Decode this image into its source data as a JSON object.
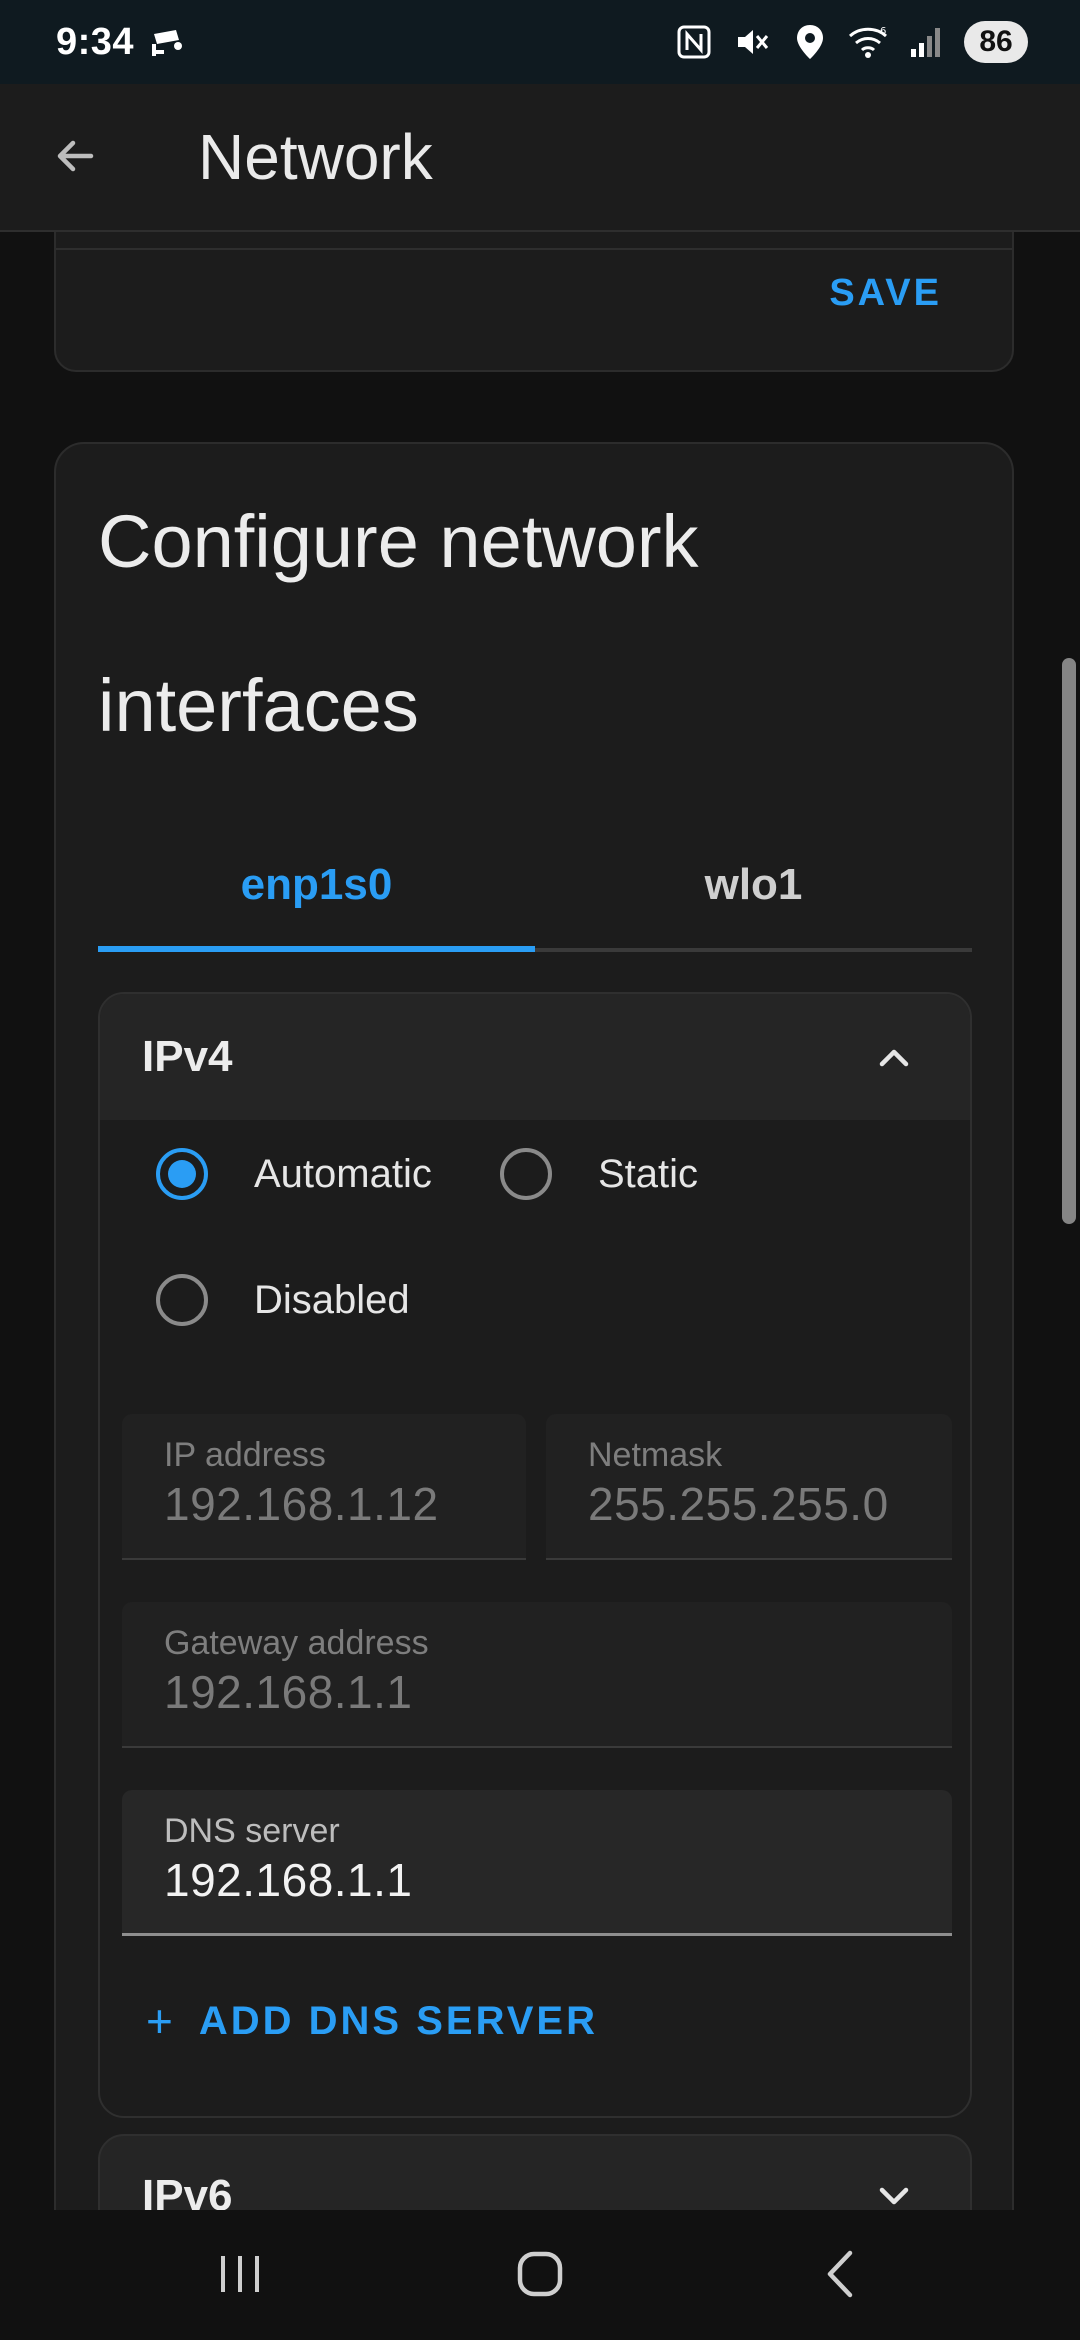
{
  "status_bar": {
    "time": "9:34",
    "battery": "86",
    "icons": [
      "cctv-icon",
      "nfc-icon",
      "mute-icon",
      "location-icon",
      "wifi-6-icon",
      "signal-icon"
    ]
  },
  "app_bar": {
    "title": "Network",
    "back_icon": "arrow-left-icon"
  },
  "top_card": {
    "save_label": "SAVE"
  },
  "configure": {
    "title": "Configure network interfaces",
    "tabs": [
      {
        "label": "enp1s0",
        "active": true
      },
      {
        "label": "wlo1",
        "active": false
      }
    ],
    "ipv4": {
      "title": "IPv4",
      "expanded": true,
      "modes": [
        {
          "label": "Automatic",
          "checked": true
        },
        {
          "label": "Static",
          "checked": false
        },
        {
          "label": "Disabled",
          "checked": false
        }
      ],
      "ip_address": {
        "label": "IP address",
        "value": "192.168.1.12"
      },
      "netmask": {
        "label": "Netmask",
        "value": "255.255.255.0"
      },
      "gateway": {
        "label": "Gateway address",
        "value": "192.168.1.1"
      },
      "dns": {
        "label": "DNS server",
        "value": "192.168.1.1"
      },
      "add_dns_plus": "+",
      "add_dns_label": "ADD DNS SERVER"
    },
    "ipv6": {
      "title": "IPv6",
      "expanded": false
    }
  },
  "colors": {
    "accent": "#2a9df4",
    "background": "#111111",
    "card": "#1c1c1c"
  }
}
